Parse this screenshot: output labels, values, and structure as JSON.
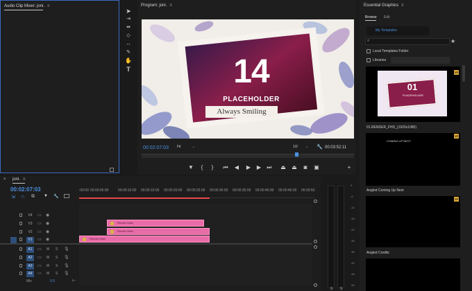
{
  "audio_mixer": {
    "title": "Audio Clip Mixer: joni."
  },
  "program": {
    "title": "Program: joni.",
    "timecode_left": "00:02:07:03",
    "fit_label": "Fit",
    "resolution": "1/2",
    "timecode_right": "00:03:52:11",
    "graphic": {
      "number": "14",
      "placeholder": "PLACEHOLDER",
      "tagline": "Always Smiling"
    }
  },
  "timeline": {
    "tab": "joni.",
    "timecode": "00:02:07:03",
    "ruler": [
      ":00:00",
      "00:00:05:00",
      "00:00:10:00",
      "00:00:15:00",
      "00:00:20:00",
      "00:00:25:00",
      "00:00:30:00",
      "00:00:35:00",
      "00:00:40:00",
      "00:00:45:00",
      "00:00:50"
    ],
    "video_tracks": [
      "V4",
      "V3",
      "V2",
      "V1"
    ],
    "audio_tracks": [
      "A1",
      "A2",
      "A3",
      "A4"
    ],
    "track_m": "M",
    "track_s": "S",
    "mix_label": "Mix",
    "mix_value": "0.0",
    "clips": [
      {
        "label": "Render Main"
      },
      {
        "label": "Render Main"
      },
      {
        "label": "Render Main"
      }
    ]
  },
  "meters": {
    "labels": [
      "0",
      "-6",
      "-12",
      "-18",
      "-24",
      "-30",
      "-36",
      "-42",
      "-48",
      "-54"
    ],
    "footer": [
      "S",
      "S"
    ]
  },
  "essential_graphics": {
    "title": "Essential Graphics",
    "tabs": [
      "Browse",
      "Edit"
    ],
    "dropdown": "My Templates",
    "local_folder": "Local Templates Folder",
    "libraries": "Libraries",
    "templates": [
      {
        "name": "01.RENDER_FHD_(1920x1080)",
        "thumb_number": "01",
        "thumb_text": "PLACEHOLDER"
      },
      {
        "name": "Angled Coming Up Next",
        "thumb_text": "COMING UP NEXT"
      },
      {
        "name": "Angled Credits"
      }
    ]
  },
  "colors": {
    "accent": "#4a90e2",
    "clip": "#e86ca8",
    "playhead": "#e84a4a",
    "badge": "#d8a431"
  }
}
